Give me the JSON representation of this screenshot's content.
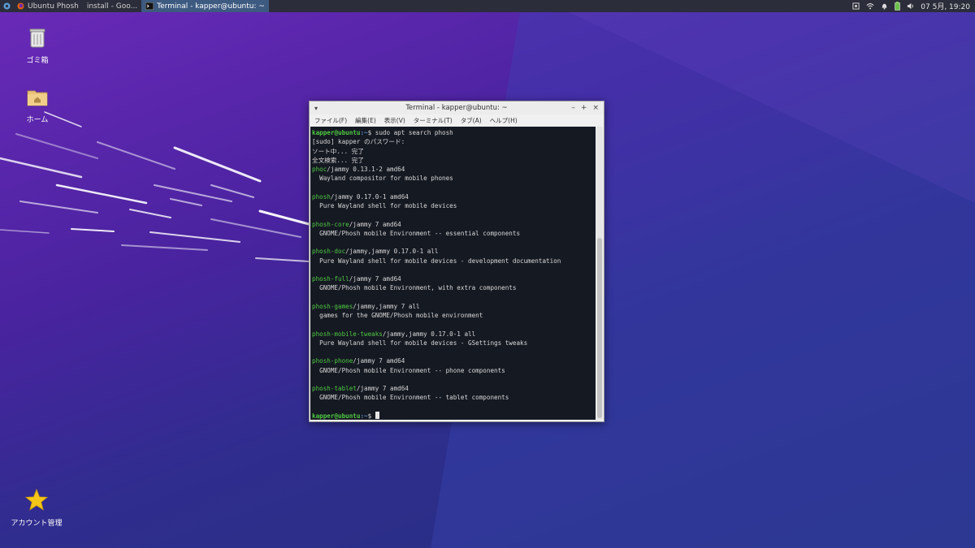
{
  "panel": {
    "tasks": [
      {
        "label": "Ubuntu Phosh",
        "icon": "firefox-icon"
      },
      {
        "label": "install - Goo...",
        "icon": ""
      },
      {
        "label": "Terminal - kapper@ubuntu: ~",
        "icon": "terminal-icon"
      }
    ],
    "clock": "07 5月, 19:20"
  },
  "desktop": {
    "icons": [
      {
        "label": "ゴミ箱",
        "icon": "trash-icon"
      },
      {
        "label": "ホーム",
        "icon": "home-folder-icon"
      },
      {
        "label": "アカウント管理",
        "icon": "star-icon"
      }
    ]
  },
  "window": {
    "title": "Terminal - kapper@ubuntu: ~",
    "menu": [
      "ファイル(F)",
      "編集(E)",
      "表示(V)",
      "ターミナル(T)",
      "タブ(A)",
      "ヘルプ(H)"
    ]
  },
  "terminal": {
    "prompt_user": "kapper@ubuntu",
    "prompt_path": ":~",
    "prompt_symbol": "$ ",
    "command": "sudo apt search phosh",
    "pre_lines": [
      "[sudo] kapper のパスワード:",
      "ソート中... 完了",
      "全文検索... 完了"
    ],
    "packages": [
      {
        "name": "phoc",
        "info": "/jammy 0.13.1-2 amd64",
        "desc": "  Wayland compositor for mobile phones"
      },
      {
        "name": "phosh",
        "info": "/jammy 0.17.0-1 amd64",
        "desc": "  Pure Wayland shell for mobile devices"
      },
      {
        "name": "phosh-core",
        "info": "/jammy 7 amd64",
        "desc": "  GNOME/Phosh mobile Environment -- essential components"
      },
      {
        "name": "phosh-doc",
        "info": "/jammy,jammy 0.17.0-1 all",
        "desc": "  Pure Wayland shell for mobile devices - development documentation"
      },
      {
        "name": "phosh-full",
        "info": "/jammy 7 amd64",
        "desc": "  GNOME/Phosh mobile Environment, with extra components"
      },
      {
        "name": "phosh-games",
        "info": "/jammy,jammy 7 all",
        "desc": "  games for the GNOME/Phosh mobile environment"
      },
      {
        "name": "phosh-mobile-tweaks",
        "info": "/jammy,jammy 0.17.0-1 all",
        "desc": "  Pure Wayland shell for mobile devices - GSettings tweaks"
      },
      {
        "name": "phosh-phone",
        "info": "/jammy 7 amd64",
        "desc": "  GNOME/Phosh mobile Environment -- phone components"
      },
      {
        "name": "phosh-tablet",
        "info": "/jammy 7 amd64",
        "desc": "  GNOME/Phosh mobile Environment -- tablet components"
      }
    ]
  }
}
